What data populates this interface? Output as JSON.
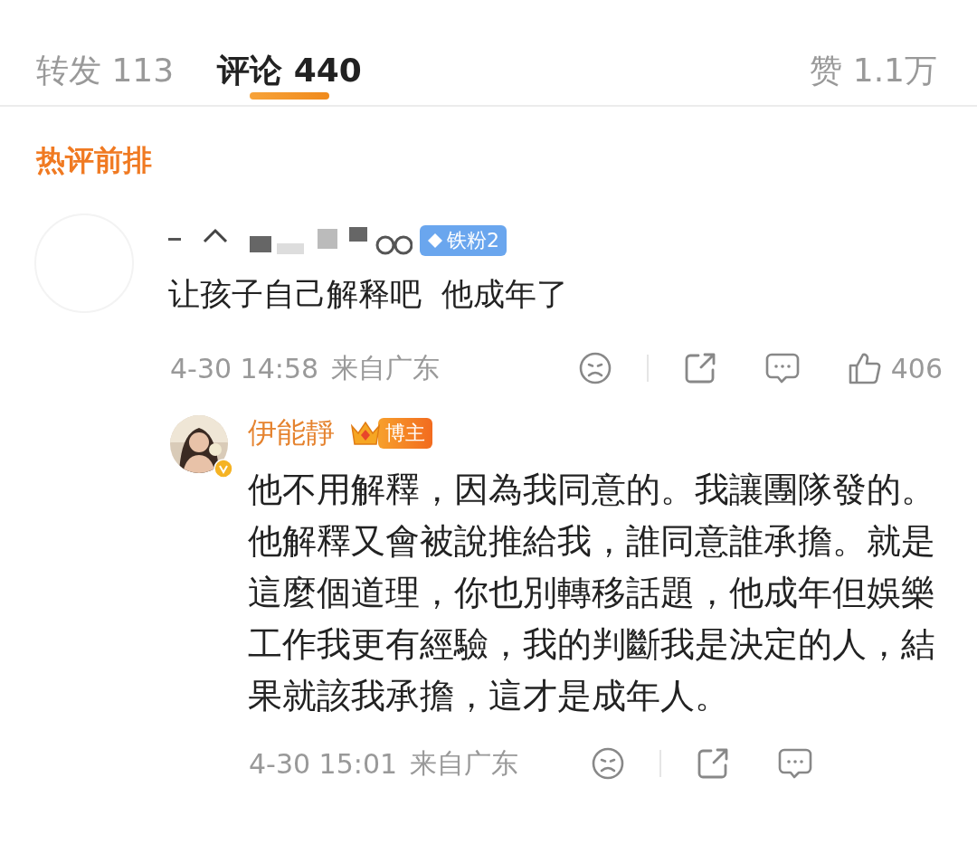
{
  "tabs": [
    {
      "label": "转发 113",
      "selected": false
    },
    {
      "label": "评论 440",
      "selected": true
    }
  ],
  "likes_tab": "赞 1.1万",
  "section_title": "热评前排",
  "comment": {
    "badge": {
      "kind": "fan",
      "text": "铁粉2"
    },
    "text": "让孩子自己解释吧  他成年了",
    "time": "4-30 14:58",
    "location": "来自广东",
    "likes": "406"
  },
  "reply": {
    "name": "伊能靜",
    "badge": {
      "kind": "author",
      "text": "博主"
    },
    "text": "他不用解釋，因為我同意的。我讓團隊發的。他解釋又會被說推給我，誰同意誰承擔。就是這麼個道理，你也別轉移話題，他成年但娛樂工作我更有經驗，我的判斷我是決定的人，結果就該我承擔，這才是成年人。",
    "time": "4-30 15:01",
    "location": "来自广东"
  }
}
